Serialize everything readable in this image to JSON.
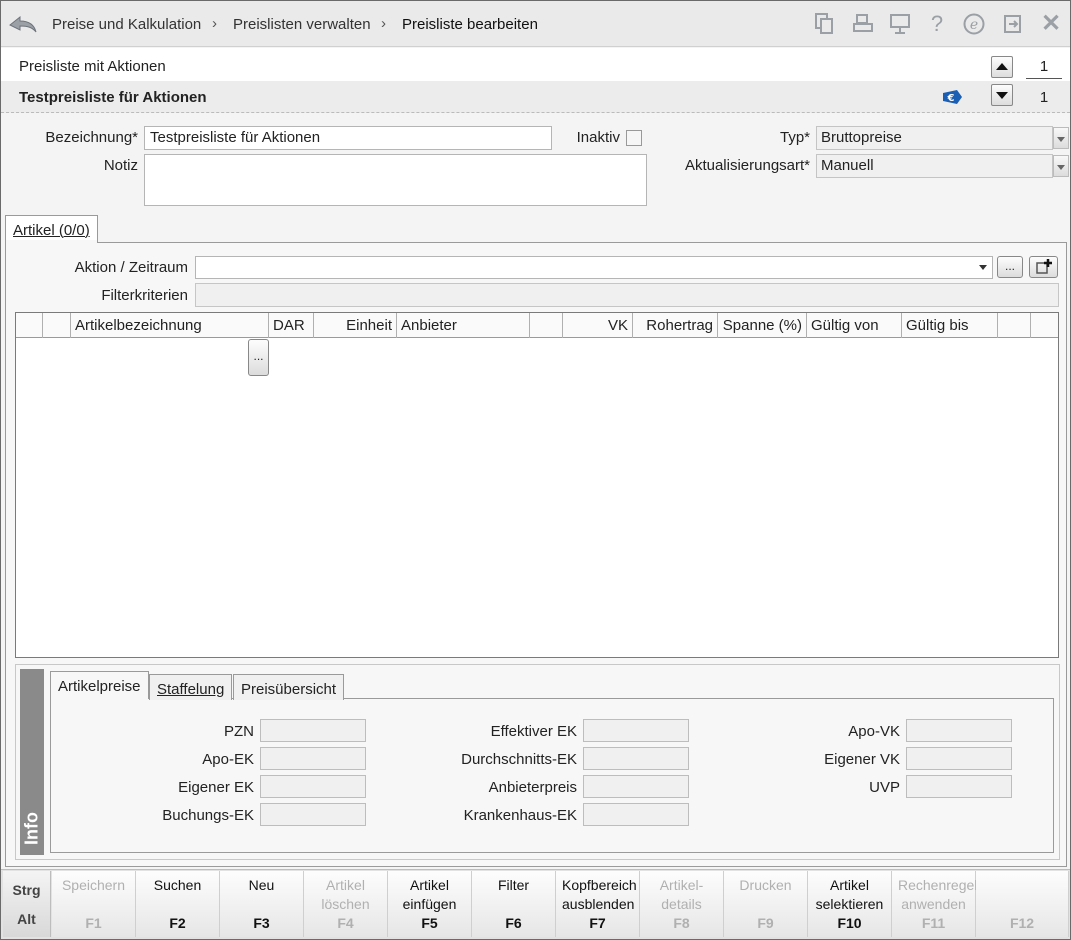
{
  "breadcrumb": {
    "items": [
      "Preise und Kalkulation",
      "Preislisten verwalten",
      "Preisliste bearbeiten"
    ],
    "separator": "›"
  },
  "header": {
    "subtitle": "Preisliste mit Aktionen",
    "title": "Testpreisliste für Aktionen",
    "counter_top": "1",
    "counter_bottom": "1"
  },
  "form": {
    "bezeichnung_label": "Bezeichnung*",
    "bezeichnung_value": "Testpreisliste für Aktionen",
    "inaktiv_label": "Inaktiv",
    "notiz_label": "Notiz",
    "notiz_value": "",
    "typ_label": "Typ*",
    "typ_value": "Bruttopreise",
    "aktualisierung_label": "Aktualisierungsart*",
    "aktualisierung_value": "Manuell"
  },
  "tabs_main": {
    "artikel_tab": "Artikel (0/0)"
  },
  "artikel": {
    "aktion_label": "Aktion / Zeitraum",
    "aktion_value": "",
    "filter_label": "Filterkriterien",
    "filter_value": "",
    "ellipsis": "..."
  },
  "table": {
    "columns": [
      "Artikelbezeichnung",
      "DAR",
      "Einheit",
      "Anbieter",
      "VK",
      "Rohertrag",
      "Spanne (%)",
      "Gültig von",
      "Gültig bis"
    ],
    "rows": []
  },
  "info": {
    "side_label": "Info",
    "tabs": [
      "Artikelpreise",
      "Staffelung",
      "Preisübersicht"
    ],
    "col1": [
      "PZN",
      "Apo-EK",
      "Eigener EK",
      "Buchungs-EK"
    ],
    "col2": [
      "Effektiver EK",
      "Durchschnitts-EK",
      "Anbieterpreis",
      "Krankenhaus-EK"
    ],
    "col3": [
      "Apo-VK",
      "Eigener VK",
      "UVP"
    ]
  },
  "fkeys": {
    "modifiers": [
      "Strg",
      "Alt"
    ],
    "keys": [
      {
        "label": "Speichern",
        "key": "F1",
        "enabled": false
      },
      {
        "label": "Suchen",
        "key": "F2",
        "enabled": true
      },
      {
        "label": "Neu",
        "key": "F3",
        "enabled": true
      },
      {
        "label": "Artikel löschen",
        "key": "F4",
        "enabled": false
      },
      {
        "label": "Artikel einfügen",
        "key": "F5",
        "enabled": true
      },
      {
        "label": "Filter",
        "key": "F6",
        "enabled": true
      },
      {
        "label": "Kopfbereich ausblenden",
        "key": "F7",
        "enabled": true
      },
      {
        "label": "Artikel-details",
        "key": "F8",
        "enabled": false
      },
      {
        "label": "Drucken",
        "key": "F9",
        "enabled": false
      },
      {
        "label": "Artikel selektieren",
        "key": "F10",
        "enabled": true
      },
      {
        "label": "Rechenregel anwenden",
        "key": "F11",
        "enabled": false
      },
      {
        "label": "",
        "key": "F12",
        "enabled": false
      }
    ]
  },
  "colors": {
    "accent": "#1a5fb4",
    "disabled_text": "#b0b0b0",
    "info_bar": "#8a8a8a"
  }
}
